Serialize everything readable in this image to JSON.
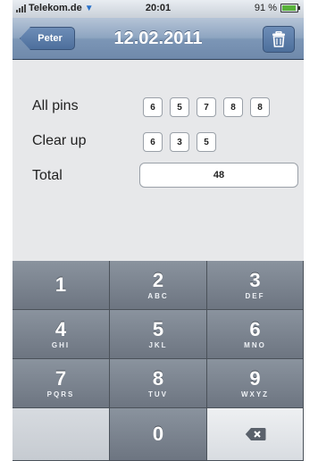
{
  "status_bar": {
    "carrier": "Telekom.de",
    "time": "20:01",
    "battery_text": "91 %",
    "battery_level": 0.91
  },
  "nav": {
    "back_label": "Peter",
    "title": "12.02.2011"
  },
  "rows": {
    "all_pins_label": "All pins",
    "all_pins_values": [
      "6",
      "5",
      "7",
      "8",
      "8"
    ],
    "clear_up_label": "Clear up",
    "clear_up_values": [
      "6",
      "3",
      "5"
    ],
    "total_label": "Total",
    "total_value": "48"
  },
  "keypad": {
    "keys": [
      {
        "num": "1",
        "letters": ""
      },
      {
        "num": "2",
        "letters": "ABC"
      },
      {
        "num": "3",
        "letters": "DEF"
      },
      {
        "num": "4",
        "letters": "GHI"
      },
      {
        "num": "5",
        "letters": "JKL"
      },
      {
        "num": "6",
        "letters": "MNO"
      },
      {
        "num": "7",
        "letters": "PQRS"
      },
      {
        "num": "8",
        "letters": "TUV"
      },
      {
        "num": "9",
        "letters": "WXYZ"
      },
      {
        "num": "0",
        "letters": ""
      }
    ]
  },
  "colors": {
    "nav_bar": "#7c96b6",
    "keypad_dark": "#6d7581",
    "keypad_light": "#eef0f2",
    "background": "#e7e8ea"
  }
}
